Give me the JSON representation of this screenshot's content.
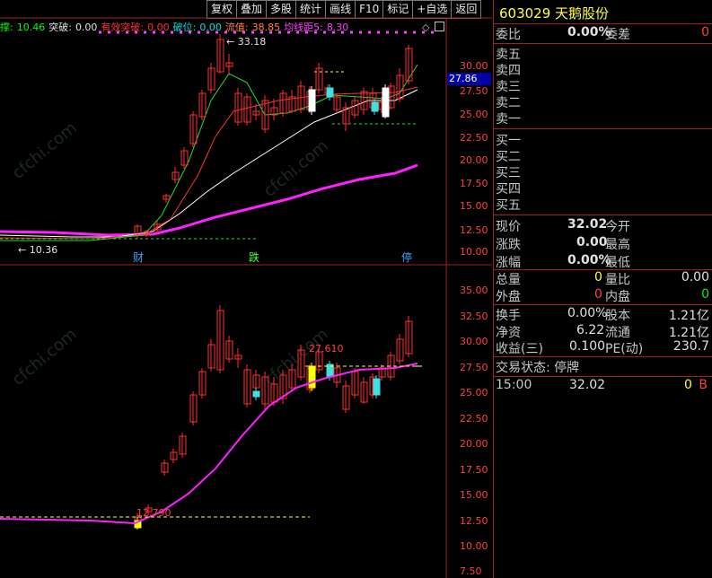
{
  "toolbar": {
    "items": [
      "复权",
      "叠加",
      "多股",
      "统计",
      "画线",
      "F10",
      "标记",
      "+自选",
      "返回"
    ]
  },
  "indicator_header": {
    "items": [
      {
        "text": "撑:",
        "color": "#00ff00"
      },
      {
        "text": "10.46",
        "color": "#00ff00"
      },
      {
        "text": "突破:",
        "color": "#e0e0e0"
      },
      {
        "text": "0.00",
        "color": "#e0e0e0"
      },
      {
        "text": "有效突破:",
        "color": "#ff3030"
      },
      {
        "text": "0.00",
        "color": "#ff3030"
      },
      {
        "text": "破位:",
        "color": "#00e0e0"
      },
      {
        "text": "0.00",
        "color": "#00e0e0"
      },
      {
        "text": "流值:",
        "color": "#ff8040"
      },
      {
        "text": "38.85",
        "color": "#ff8040"
      },
      {
        "text": "均线距5:",
        "color": "#ff40ff"
      },
      {
        "text": "8.30",
        "color": "#ff40ff"
      }
    ]
  },
  "chart": {
    "upper_axis": [
      "30.00",
      "27.50",
      "25.00",
      "22.50",
      "20.00",
      "17.50",
      "15.00",
      "12.50",
      "10.00"
    ],
    "lower_axis": [
      "35.00",
      "32.50",
      "30.00",
      "27.50",
      "25.00",
      "22.50",
      "20.00",
      "17.50",
      "15.00",
      "12.50",
      "10.00",
      "7.50"
    ],
    "current_price_tag": "27.86",
    "high_label": "33.18",
    "low_label": "10.36",
    "event_labels": [
      "财",
      "跌",
      "停"
    ],
    "annot_1": "27.610",
    "annot_2": "12.790",
    "watermark": "cfchi.com"
  },
  "stock": {
    "code": "603029",
    "name": "天鹅股份"
  },
  "order_book": {
    "weibi_label": "委比",
    "weibi_value": "0.00%",
    "weicha_label": "委差",
    "weicha_value": "0",
    "sell": [
      "卖五",
      "卖四",
      "卖三",
      "卖二",
      "卖一"
    ],
    "buy": [
      "买一",
      "买二",
      "买三",
      "买四",
      "买五"
    ]
  },
  "quote": {
    "xianjia_label": "现价",
    "xianjia": "32.02",
    "jinkai_label": "今开",
    "zhangdie_label": "涨跌",
    "zhangdie": "0.00",
    "zuigao_label": "最高",
    "zhangfu_label": "涨幅",
    "zhangfu": "0.00%",
    "zuidi_label": "最低",
    "zongliang_label": "总量",
    "zongliang": "0",
    "liangbi_label": "量比",
    "liangbi": "0.00",
    "waipan_label": "外盘",
    "waipan": "0",
    "neipan_label": "内盘",
    "neipan": "0",
    "huanshou_label": "换手",
    "huanshou": "0.00%",
    "guben_label": "股本",
    "guben": "1.21亿",
    "jingzi_label": "净资",
    "jingzi": "6.22",
    "liutong_label": "流通",
    "liutong": "1.21亿",
    "shouyi_label": "收益(三)",
    "shouyi": "0.100",
    "pe_label": "PE(动)",
    "pe": "230.7"
  },
  "status": {
    "label": "交易状态:",
    "value": "停牌"
  },
  "tick": {
    "time": "15:00",
    "price": "32.02",
    "vol": "0",
    "side": "B"
  }
}
